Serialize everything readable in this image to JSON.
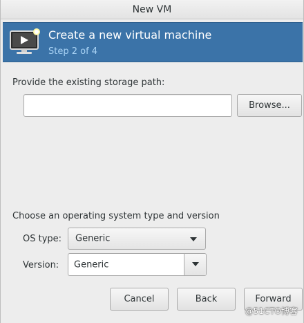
{
  "window": {
    "title": "New VM"
  },
  "banner": {
    "title": "Create a new virtual machine",
    "step": "Step 2 of 4",
    "icon": "vm-monitor-icon"
  },
  "storage": {
    "label": "Provide the existing storage path:",
    "path_value": "",
    "browse_label": "Browse..."
  },
  "os": {
    "section_label": "Choose an operating system type and version",
    "type_label": "OS type:",
    "type_value": "Generic",
    "version_label": "Version:",
    "version_value": "Generic"
  },
  "buttons": {
    "cancel": "Cancel",
    "back": "Back",
    "forward": "Forward"
  },
  "watermark": "@51CTO博客",
  "colors": {
    "banner": "#3b73a8",
    "step_text": "#a9d3f5",
    "window_bg": "#ededed"
  }
}
